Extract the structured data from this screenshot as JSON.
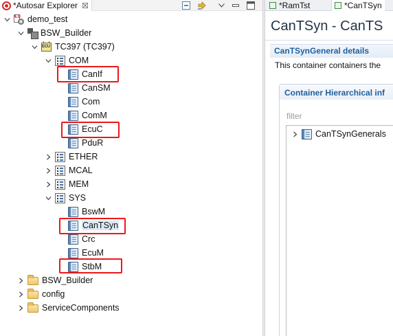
{
  "explorer": {
    "tab_title": "*Autosar Explorer",
    "close_glyph": "☒",
    "tree": {
      "project": "demo_test",
      "builder": "BSW_Builder",
      "ecu": "TC397 (TC397)",
      "com": {
        "label": "COM",
        "children": [
          "CanIf",
          "CanSM",
          "Com",
          "ComM",
          "EcuC",
          "PduR"
        ]
      },
      "ether": "ETHER",
      "mcal": "MCAL",
      "mem": "MEM",
      "sys": {
        "label": "SYS",
        "children": [
          "BswM",
          "CanTSyn",
          "Crc",
          "EcuM",
          "StbM"
        ]
      },
      "folders": [
        "BSW_Builder",
        "config",
        "ServiceComponents"
      ]
    },
    "highlighted_items": [
      "CanIf",
      "EcuC",
      "CanTSyn",
      "StbM"
    ]
  },
  "editor": {
    "tabs": [
      "*RamTst",
      "*CanTSyn"
    ],
    "title": "CanTSyn - CanTS",
    "details_title": "CanTSynGeneral details",
    "details_description": "This container containers the",
    "hierarchy_title": "Container Hierarchical inf",
    "filter_placeholder": "filter",
    "tree_item": "CanTSynGenerals"
  },
  "colors": {
    "highlight_box": "#ea1818",
    "section_title": "#1f5f9e"
  }
}
